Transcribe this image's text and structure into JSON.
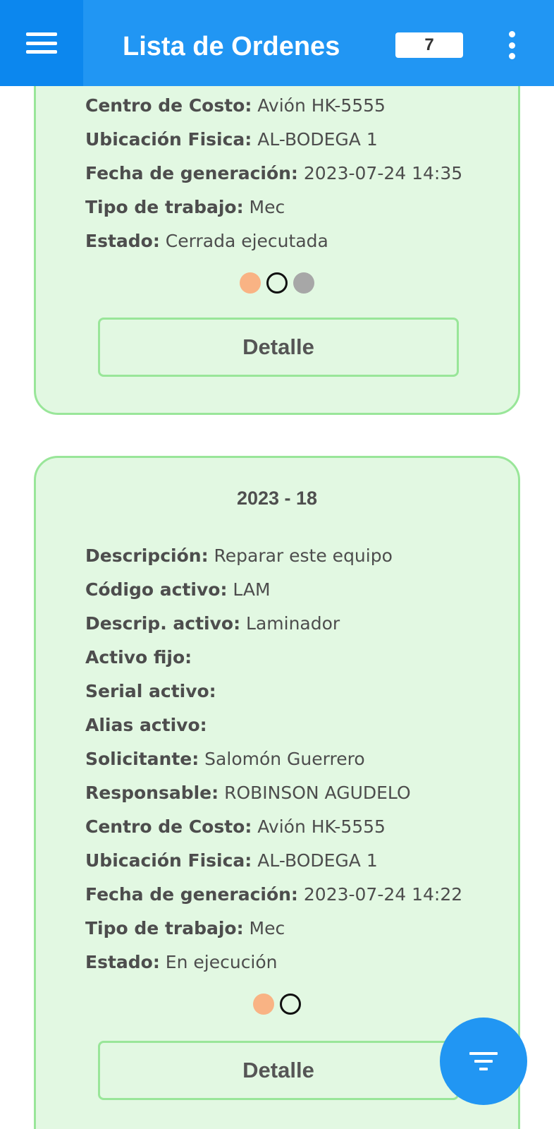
{
  "appbar": {
    "title": "Lista de Ordenes",
    "count": "7",
    "menu_icon": "hamburger-menu-icon",
    "more_icon": "more-vertical-icon"
  },
  "cards": [
    {
      "fields": [
        {
          "label": "Centro de Costo:",
          "value": " Avión HK-5555"
        },
        {
          "label": "Ubicación Fisica:",
          "value": " AL-BODEGA 1"
        },
        {
          "label": "Fecha de generación:",
          "value": " 2023-07-24 14:35"
        },
        {
          "label": "Tipo de trabajo:",
          "value": " Mec"
        },
        {
          "label": "Estado:",
          "value": " Cerrada ejecutada"
        }
      ],
      "status_dots": [
        "orange",
        "outline",
        "grey"
      ],
      "button_label": "Detalle"
    },
    {
      "title": "2023 - 18",
      "fields": [
        {
          "label": "Descripción:",
          "value": " Reparar este equipo"
        },
        {
          "label": "Código activo:",
          "value": " LAM"
        },
        {
          "label": "Descrip. activo:",
          "value": " Laminador"
        },
        {
          "label": "Activo fijo:",
          "value": ""
        },
        {
          "label": "Serial activo:",
          "value": ""
        },
        {
          "label": "Alias activo:",
          "value": ""
        },
        {
          "label": "Solicitante:",
          "value": " Salomón Guerrero"
        },
        {
          "label": "Responsable:",
          "value": " ROBINSON AGUDELO"
        },
        {
          "label": "Centro de Costo:",
          "value": " Avión HK-5555"
        },
        {
          "label": "Ubicación Fisica:",
          "value": " AL-BODEGA 1"
        },
        {
          "label": "Fecha de generación:",
          "value": " 2023-07-24 14:22"
        },
        {
          "label": "Tipo de trabajo:",
          "value": " Mec"
        },
        {
          "label": "Estado:",
          "value": " En ejecución"
        }
      ],
      "status_dots": [
        "orange",
        "outline"
      ],
      "button_label": "Detalle"
    }
  ],
  "fab": {
    "icon": "filter-icon"
  },
  "colors": {
    "primary": "#2196f3",
    "card_bg": "#e2f8e2",
    "card_border": "#99e699",
    "status_orange": "#f9b384",
    "status_grey": "#a7a7a7"
  }
}
